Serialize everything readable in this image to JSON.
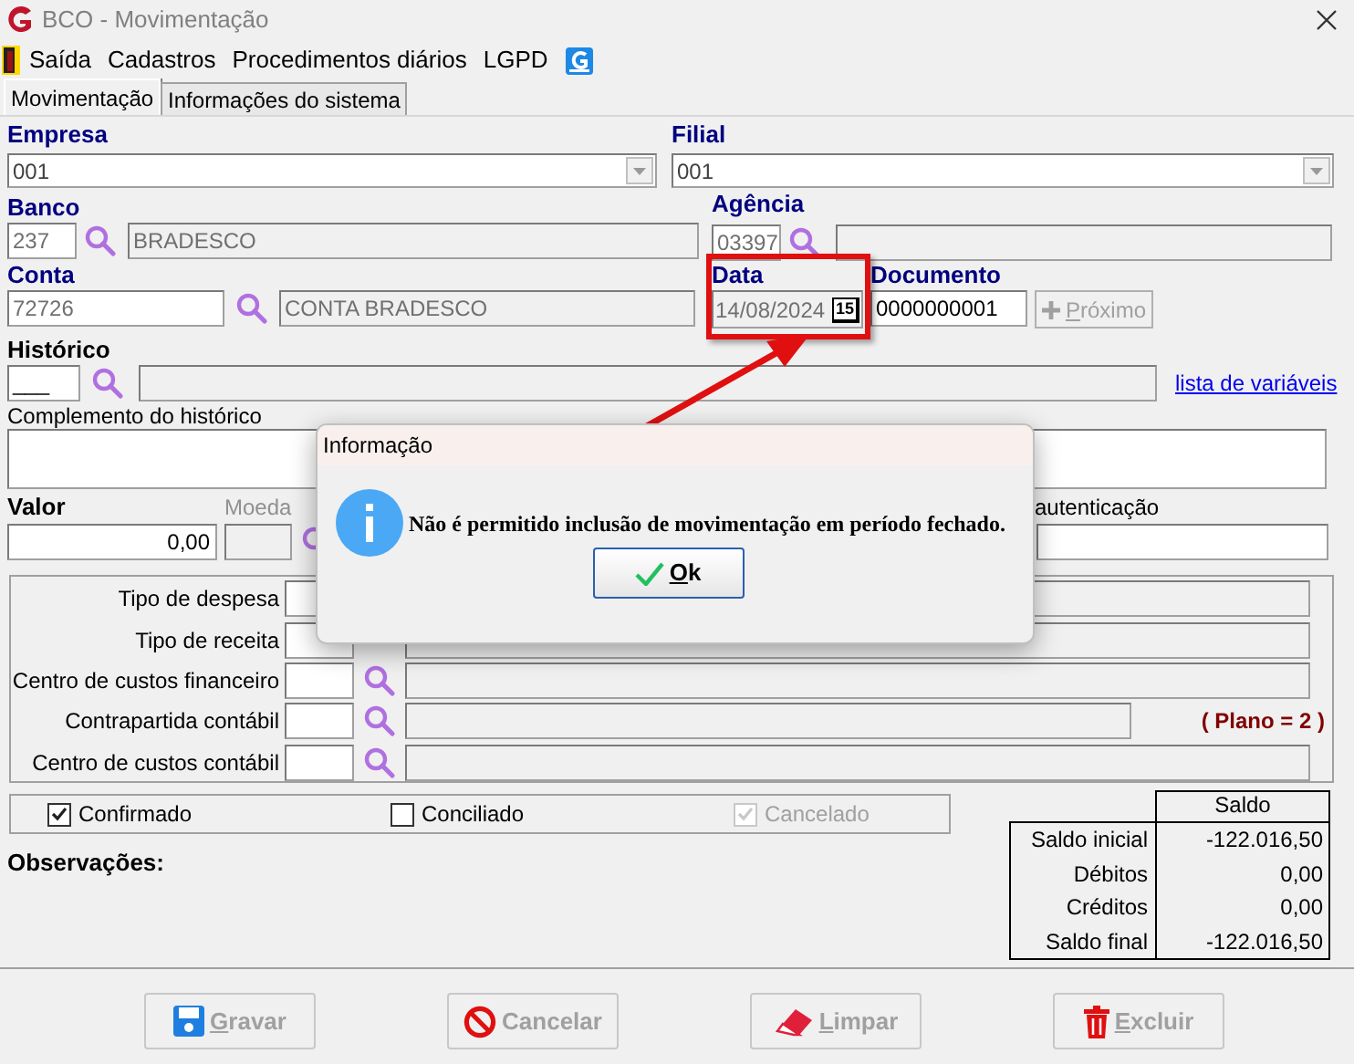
{
  "window": {
    "title": "BCO - Movimentação"
  },
  "menu": [
    "Saída",
    "Cadastros",
    "Procedimentos diários",
    "LGPD"
  ],
  "tabs": [
    {
      "label": "Movimentação",
      "selected": true
    },
    {
      "label": "Informações do sistema",
      "selected": false
    }
  ],
  "form": {
    "empresa": {
      "label": "Empresa",
      "value": "001"
    },
    "filial": {
      "label": "Filial",
      "value": "001"
    },
    "banco": {
      "label": "Banco",
      "code": "237",
      "name": "BRADESCO"
    },
    "agencia": {
      "label": "Agência",
      "code": "03397"
    },
    "conta": {
      "label": "Conta",
      "code": "72726",
      "name": "CONTA BRADESCO"
    },
    "data": {
      "label": "Data",
      "value": "14/08/2024",
      "calendar_day": "15"
    },
    "documento": {
      "label": "Documento",
      "value": "0000000001"
    },
    "proximo": {
      "label": "Próximo",
      "disabled": true
    },
    "historico": {
      "label": "Histórico",
      "code": "___"
    },
    "variables_link": "lista de variáveis",
    "complemento": {
      "label": "Complemento do histórico"
    },
    "valor": {
      "label": "Valor",
      "value": "0,00"
    },
    "moeda": {
      "label": "Moeda",
      "disabled": true
    },
    "autenticacao": {
      "label": "autenticação"
    }
  },
  "classification": {
    "rows": [
      {
        "label": "Tipo de despesa",
        "lookup": false
      },
      {
        "label": "Tipo de receita",
        "lookup": false
      },
      {
        "label": "Centro de custos financeiro",
        "lookup": true
      },
      {
        "label": "Contrapartida contábil",
        "lookup": true,
        "note": "( Plano = 2 )"
      },
      {
        "label": "Centro de custos contábil",
        "lookup": true
      }
    ]
  },
  "checkboxes": [
    {
      "label": "Confirmado",
      "checked": true,
      "disabled": false
    },
    {
      "label": "Conciliado",
      "checked": false,
      "disabled": false
    },
    {
      "label": "Cancelado",
      "checked": true,
      "disabled": true
    }
  ],
  "observacoes": "Observações:",
  "saldo": {
    "header": "Saldo",
    "rows": [
      {
        "label": "Saldo inicial",
        "value": "-122.016,50"
      },
      {
        "label": "Débitos",
        "value": "0,00"
      },
      {
        "label": "Créditos",
        "value": "0,00"
      },
      {
        "label": "Saldo final",
        "value": "-122.016,50"
      }
    ]
  },
  "buttons": [
    {
      "label": "Gravar",
      "kind": "save",
      "disabled": true,
      "accelerator": true
    },
    {
      "label": "Cancelar",
      "kind": "cancel",
      "disabled": true,
      "accelerator": false
    },
    {
      "label": "Limpar",
      "kind": "clear",
      "disabled": true,
      "accelerator": true
    },
    {
      "label": "Excluir",
      "kind": "delete",
      "disabled": true,
      "accelerator": true
    }
  ],
  "dialog": {
    "title": "Informação",
    "message": "Não é permitido inclusão de movimentação em período fechado.",
    "button": "Ok"
  }
}
